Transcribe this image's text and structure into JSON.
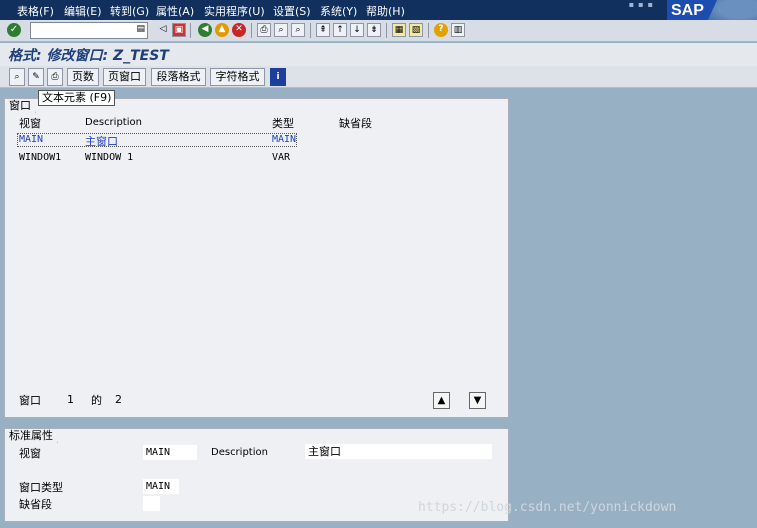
{
  "menu": {
    "items": [
      "表格(F)",
      "编辑(E)",
      "转到(G)",
      "属性(A)",
      "实用程序(U)",
      "设置(S)",
      "系统(Y)",
      "帮助(H)"
    ],
    "brand": "SAP"
  },
  "title": "格式: 修改窗口: Z_TEST",
  "toolbar": {
    "icons": [
      "back-icon",
      "save-icon",
      "exit-icon",
      "cancel-icon",
      "print-icon",
      "find-icon",
      "find-next-icon",
      "first-page-icon",
      "prev-page-icon",
      "next-page-icon",
      "last-page-icon",
      "new-session-icon",
      "shortcut-icon",
      "help-icon",
      "layout-icon"
    ]
  },
  "appbar": {
    "pages": "页数",
    "page_windows": "页窗口",
    "paragraph_formats": "段落格式",
    "character_formats": "字符格式"
  },
  "tooltip": "文本元素   (F9)",
  "windows_panel": {
    "tab": "窗口",
    "headers": {
      "view": "视窗",
      "description": "Description",
      "type": "类型",
      "default_paragraph": "缺省段"
    },
    "rows": [
      {
        "view": "MAIN",
        "description": "主窗口",
        "type": "MAIN"
      },
      {
        "view": "WINDOW1",
        "description": "WINDOW 1",
        "type": "VAR"
      }
    ],
    "footer": {
      "label": "窗口",
      "current": "1",
      "of": "的",
      "total": "2"
    }
  },
  "attributes_panel": {
    "tab": "标准属性",
    "view_label": "视窗",
    "view_value": "MAIN",
    "description_label": "Description",
    "description_value": "主窗口",
    "window_type_label": "窗口类型",
    "window_type_value": "MAIN",
    "default_paragraph_label": "缺省段",
    "default_paragraph_value": ""
  },
  "watermark": "https://blog.csdn.net/yonnickdown"
}
